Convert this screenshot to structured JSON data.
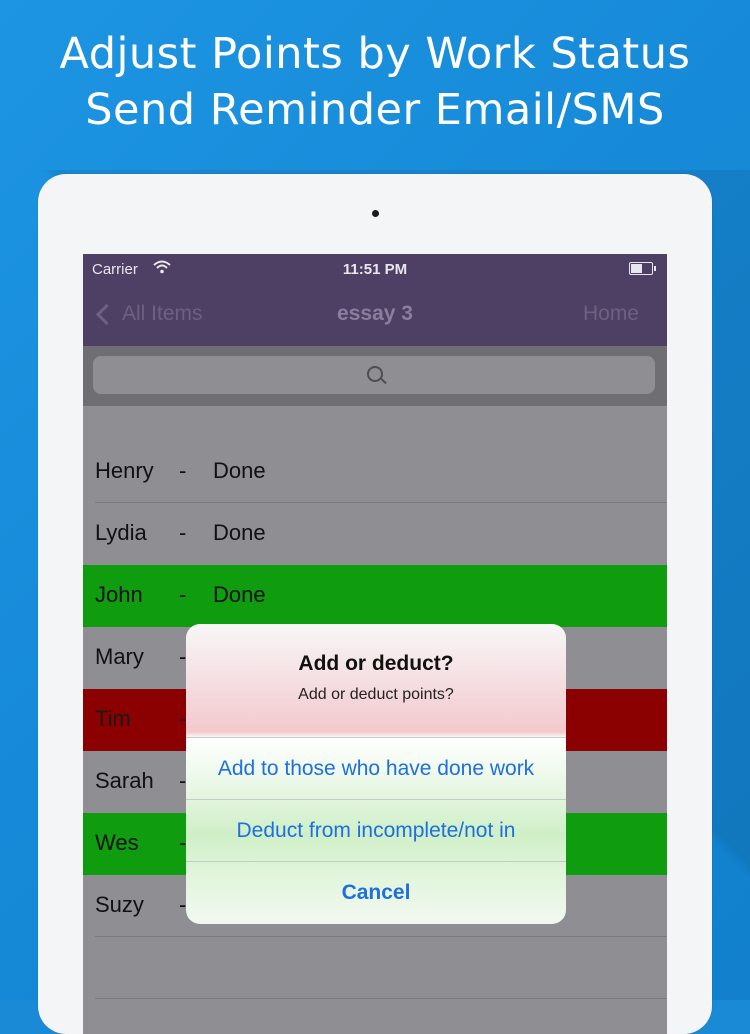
{
  "promo": {
    "headline_line1": "Adjust Points by Work Status",
    "headline_line2": "Send Reminder Email/SMS"
  },
  "status_bar": {
    "carrier": "Carrier",
    "time": "11:51 PM"
  },
  "nav": {
    "back_label": "All Items",
    "title": "essay 3",
    "right_label": "Home"
  },
  "list": {
    "separator": "-",
    "rows": [
      {
        "name": "Henry",
        "status": "Done",
        "highlight": "none"
      },
      {
        "name": "Lydia",
        "status": "Done",
        "highlight": "none"
      },
      {
        "name": "John",
        "status": "Done",
        "highlight": "green"
      },
      {
        "name": "Mary",
        "status": "",
        "highlight": "none"
      },
      {
        "name": "Tim",
        "status": "",
        "highlight": "red"
      },
      {
        "name": "Sarah",
        "status": "",
        "highlight": "none"
      },
      {
        "name": "Wes",
        "status": "",
        "highlight": "green"
      },
      {
        "name": "Suzy",
        "status": "",
        "highlight": "none"
      }
    ]
  },
  "alert": {
    "title": "Add or deduct?",
    "message": "Add or deduct points?",
    "add_label": "Add to those who have done work",
    "deduct_label": "Deduct from incomplete/not in",
    "cancel_label": "Cancel"
  },
  "colors": {
    "background": "#1a8ad6",
    "nav": "#4e3f64",
    "row_green": "#0f9c0f",
    "row_red": "#8b0000",
    "alert_button": "#1e6fe0"
  }
}
